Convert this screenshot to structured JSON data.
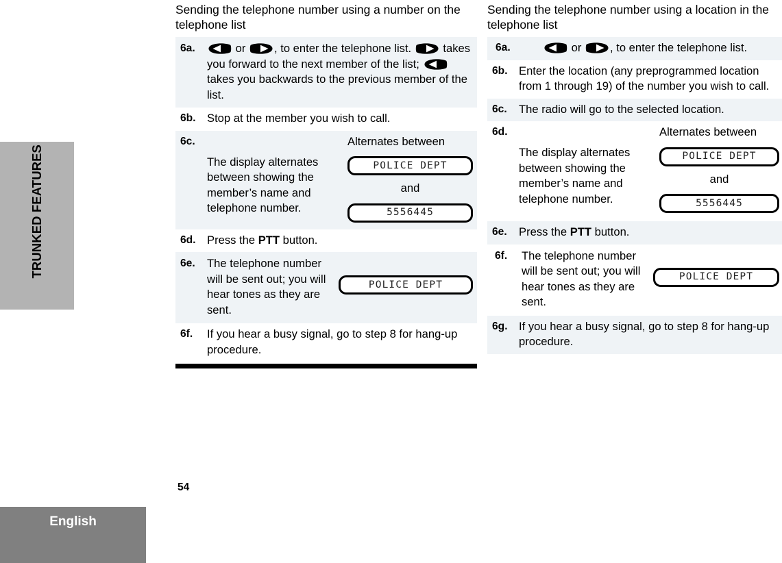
{
  "chapter_tab": {
    "label": "TRUNKED FEATURES"
  },
  "footer": {
    "language": "English",
    "page_number": "54"
  },
  "left_column": {
    "intro": "Sending the telephone number using a number on the telephone list",
    "steps": [
      {
        "num": "6a.",
        "tint": true,
        "text_before": "",
        "text_mid": " or ",
        "text_after": ", to enter the telephone list. ",
        "text_after2": " takes you forward to the next member of the list; ",
        "text_after3": " takes you backwards to the previous member of the list."
      },
      {
        "num": "6b.",
        "tint": false,
        "text": "Stop at the member you wish to call."
      },
      {
        "num": "6c.",
        "tint": true,
        "text": "The display alternates between showing the member’s name and telephone number.",
        "alternates_caption": "Alternates between",
        "and_caption": "and",
        "display_1": "POLICE DEPT",
        "display_2": "5556445"
      },
      {
        "num": "6d.",
        "tint": false,
        "text_pre": "Press the ",
        "bold": "PTT",
        "text_post": " button."
      },
      {
        "num": "6e.",
        "tint": true,
        "text": "The telephone number will be sent out; you will hear tones as they are sent.",
        "display_1": "POLICE DEPT"
      },
      {
        "num": "6f.",
        "tint": false,
        "text": "If you hear a busy signal, go to step 8 for hang-up procedure."
      }
    ]
  },
  "right_column": {
    "intro": "Sending the telephone number using a location in the telephone list",
    "steps": [
      {
        "num": "6a.",
        "tint": true,
        "text_mid": " or ",
        "text_after": ", to enter the telephone list."
      },
      {
        "num": "6b.",
        "tint": false,
        "text": "Enter the location (any preprogrammed location from 1 through 19) of the number you wish to call."
      },
      {
        "num": "6c.",
        "tint": true,
        "text": "The radio will go to the selected location."
      },
      {
        "num": "6d.",
        "tint": false,
        "text": "The display alternates between showing the member’s name and telephone number.",
        "alternates_caption": "Alternates between",
        "and_caption": "and",
        "display_1": "POLICE DEPT",
        "display_2": "5556445"
      },
      {
        "num": "6e.",
        "tint": true,
        "text_pre": "Press the ",
        "bold": "PTT",
        "text_post": " button."
      },
      {
        "num": "6f.",
        "tint": false,
        "text": "The telephone number will be sent out; you will hear tones as they are sent.",
        "display_1": "POLICE DEPT"
      },
      {
        "num": "6g.",
        "tint": true,
        "text": "If you hear a busy signal, go to step 8 for hang-up procedure."
      }
    ]
  },
  "icons": {
    "left_arrow": "nav-left-arrow-icon",
    "right_arrow": "nav-right-arrow-icon"
  },
  "colors": {
    "tint_row": "#eff3f6",
    "chapter_tab": "#b3b3b3",
    "language_block": "#808080",
    "rule": "#000000"
  }
}
